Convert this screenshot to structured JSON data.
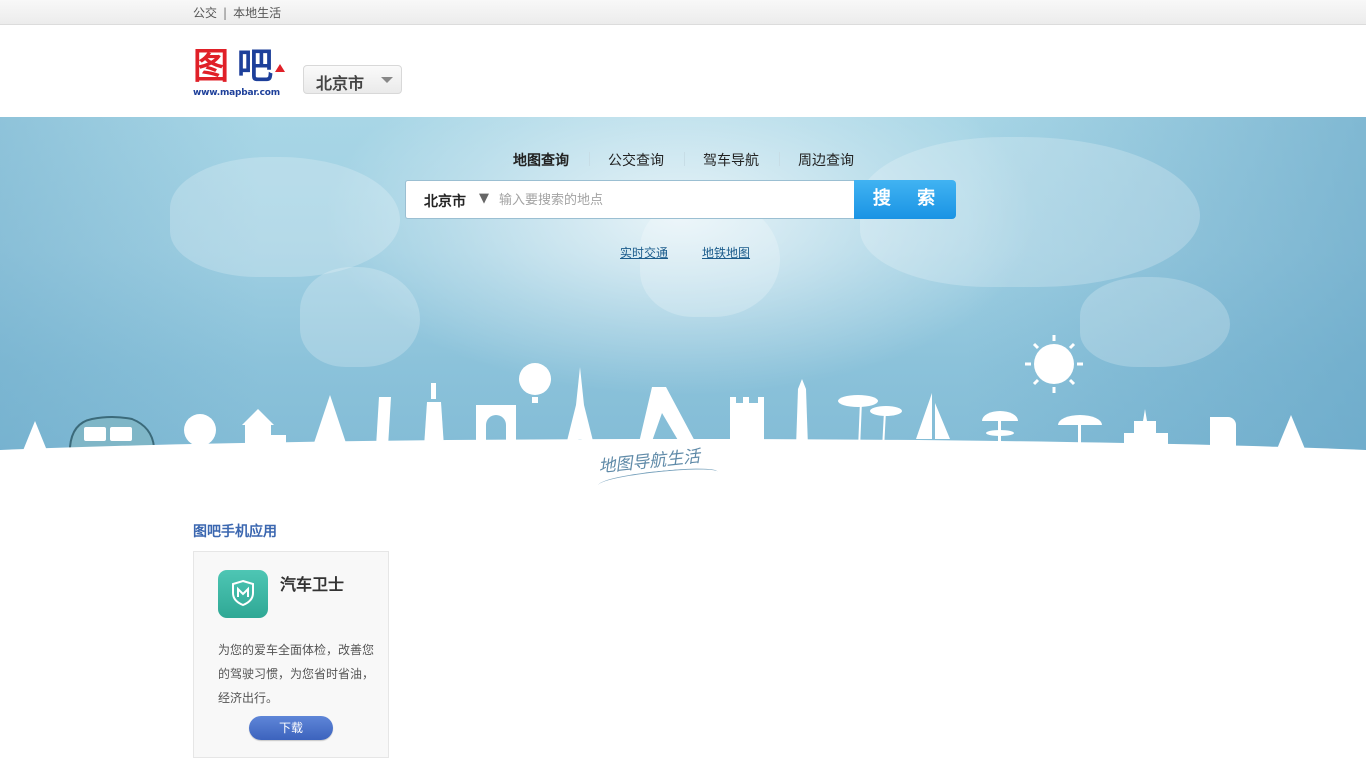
{
  "topbar": {
    "links": [
      "公交",
      "本地生活"
    ],
    "separator": "|"
  },
  "header": {
    "logo": {
      "char1": "图",
      "char2": "吧",
      "url": "www.mapbar.com"
    },
    "city_select": {
      "value": "北京市"
    }
  },
  "search": {
    "tabs": [
      "地图查询",
      "公交查询",
      "驾车导航",
      "周边查询"
    ],
    "active_tab": "地图查询",
    "city": "北京市",
    "city_caret": "▼",
    "placeholder": "输入要搜索的地点",
    "button_label": "搜 索",
    "links": [
      "实时交通",
      "地铁地图"
    ]
  },
  "hero": {
    "slogan": "地图导航生活"
  },
  "apps": {
    "title": "图吧手机应用",
    "items": [
      {
        "name": "汽车卫士",
        "icon": "shield-m-icon",
        "description": "为您的爱车全面体检，改善您的驾驶习惯，为您省时省油，经济出行。",
        "download_label": "下载"
      }
    ]
  },
  "colors": {
    "brand_red": "#e02028",
    "brand_blue": "#1d3f9a",
    "search_button": "#1a93e4",
    "section_title": "#3b67b0",
    "app_icon": "#3fb8a5"
  }
}
